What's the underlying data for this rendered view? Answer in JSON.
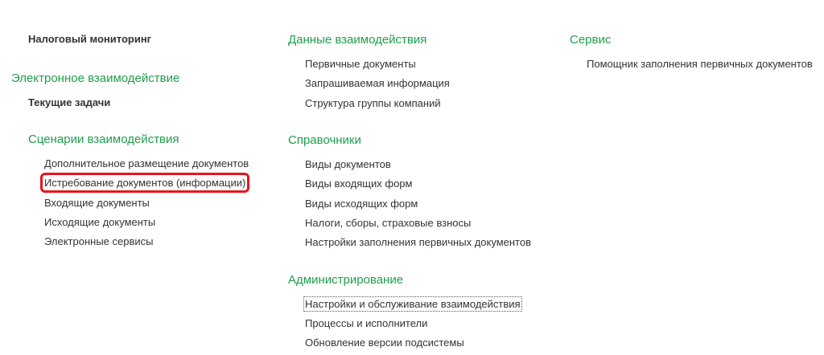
{
  "col1": {
    "tax_monitoring": "Налоговый мониторинг",
    "electronic": {
      "title": "Электронное взаимодействие",
      "current_tasks": "Текущие задачи"
    },
    "scenarios": {
      "title": "Сценарии взаимодействия",
      "items": [
        "Дополнительное размещение документов",
        "Истребование документов (информации)",
        "Входящие документы",
        "Исходящие документы",
        "Электронные сервисы"
      ]
    }
  },
  "col2": {
    "interaction_data": {
      "title": "Данные взаимодействия",
      "items": [
        "Первичные документы",
        "Запрашиваемая информация",
        "Структура группы компаний"
      ]
    },
    "references": {
      "title": "Справочники",
      "items": [
        "Виды документов",
        "Виды входящих форм",
        "Виды исходящих форм",
        "Налоги, сборы, страховые взносы",
        "Настройки заполнения первичных документов"
      ]
    },
    "administration": {
      "title": "Администрирование",
      "items": [
        "Настройки и обслуживание взаимодействия",
        "Процессы и исполнители",
        "Обновление версии подсистемы"
      ]
    }
  },
  "col3": {
    "service": {
      "title": "Сервис",
      "items": [
        "Помощник заполнения первичных документов"
      ]
    }
  },
  "colors": {
    "group_title": "#1f9f4b",
    "text": "#333333",
    "highlight": "#e8141c"
  }
}
